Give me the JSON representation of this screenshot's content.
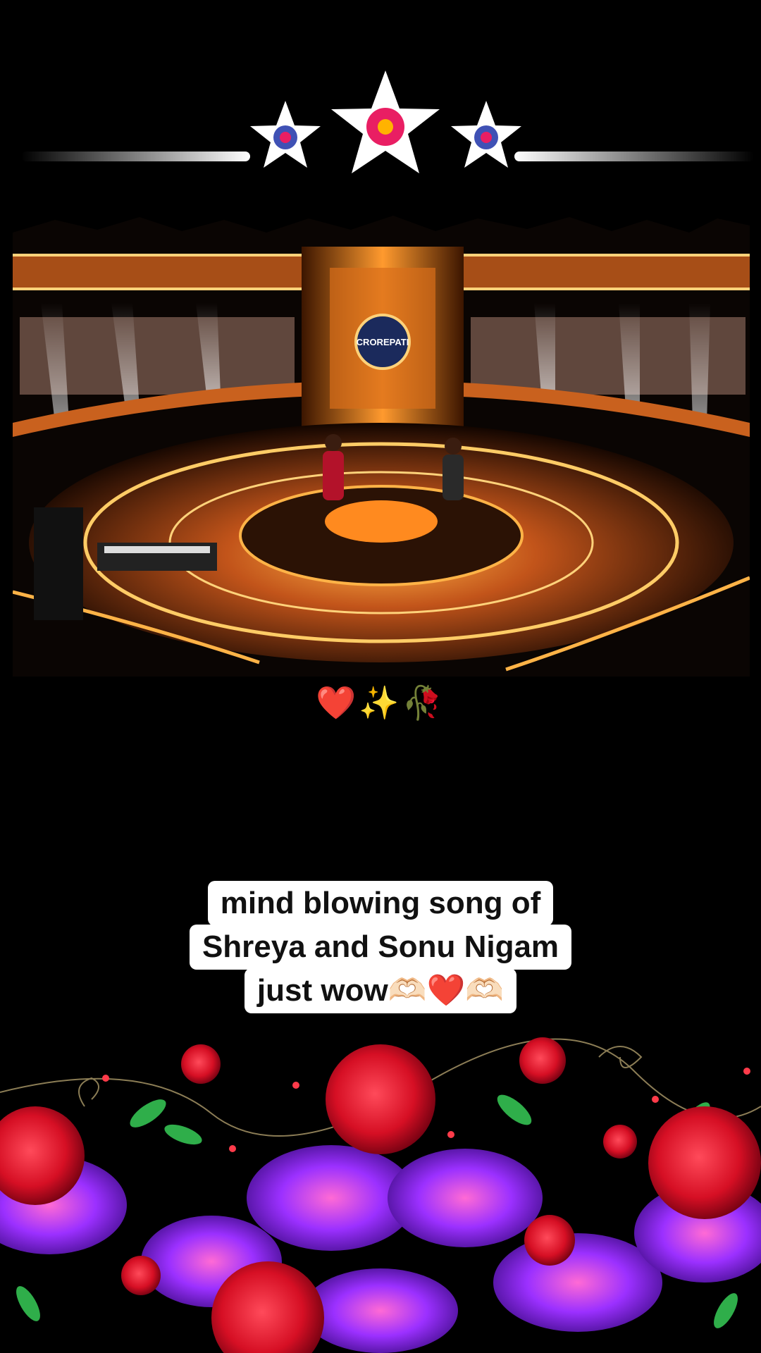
{
  "emojis": "❤️✨🥀",
  "caption": {
    "line1": "mind blowing song of",
    "line2": "Shreya and Sonu Nigam",
    "line3": "just wow🫶🏻❤️🫶🏻"
  },
  "video": {
    "logo_text": "CROREPATI"
  },
  "colors": {
    "background": "#000000",
    "stage_gold": "#f5a623",
    "stage_orange": "#e8621b",
    "rose_red": "#e0102a",
    "flower_purple": "#8a2be2",
    "star_white": "#ffffff",
    "star_pink": "#e91e63",
    "star_blue": "#3f51b5"
  }
}
